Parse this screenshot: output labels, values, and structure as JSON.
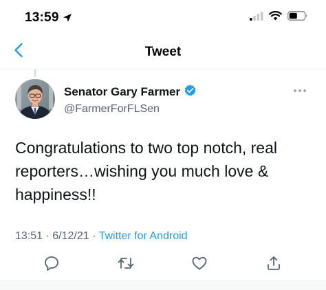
{
  "status_bar": {
    "time": "13:59"
  },
  "nav": {
    "title": "Tweet"
  },
  "tweet": {
    "author_name": "Senator Gary Farmer",
    "author_handle": "@FarmerForFLSen",
    "verified": true,
    "text": "Congratulations to two top notch, real reporters…wishing you much love & happiness!!",
    "time": "13:51",
    "date": "6/12/21",
    "source": "Twitter for Android",
    "separator": " · "
  },
  "actions": [
    "reply",
    "retweet",
    "like",
    "share"
  ],
  "colors": {
    "accent": "#1d9bf0",
    "secondary_text": "#536471",
    "icon": "#536471"
  },
  "icons": {
    "back": "chevron-left-icon",
    "more": "more-horizontal-icon",
    "verified": "verified-badge-icon"
  }
}
